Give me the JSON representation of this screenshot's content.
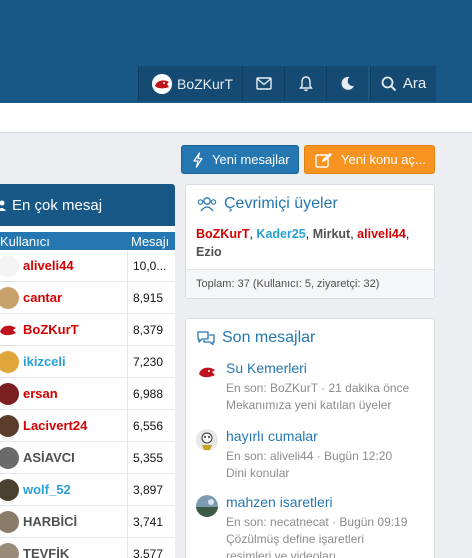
{
  "nav": {
    "user": "BoZKurT",
    "search": "Ara"
  },
  "buttons": {
    "new_messages": "Yeni mesajlar",
    "new_thread": "Yeni konu aç..."
  },
  "top_posters": {
    "title": "En çok mesaj",
    "col_user": "Kullanıcı",
    "col_messages": "Mesajı",
    "rows": [
      {
        "name": "aliveli44",
        "count": "10,0...",
        "color": "#d40000"
      },
      {
        "name": "cantar",
        "count": "8,915",
        "color": "#d40000"
      },
      {
        "name": "BoZKurT",
        "count": "8,379",
        "color": "#d40000"
      },
      {
        "name": "ikizceli",
        "count": "7,230",
        "color": "#2aa0d6"
      },
      {
        "name": "ersan",
        "count": "6,988",
        "color": "#d40000"
      },
      {
        "name": "Lacivert24",
        "count": "6,556",
        "color": "#d40000"
      },
      {
        "name": "ASİAVCI",
        "count": "5,355",
        "color": "#505050"
      },
      {
        "name": "wolf_52",
        "count": "3,897",
        "color": "#2aa0d6"
      },
      {
        "name": "HARBİCİ",
        "count": "3,741",
        "color": "#505050"
      },
      {
        "name": "TEVFİK",
        "count": "3,577",
        "color": "#505050"
      }
    ]
  },
  "online": {
    "title": "Çevrimiçi üyeler",
    "users": [
      {
        "name": "BoZKurT",
        "color": "#d40000"
      },
      {
        "name": "Kader25",
        "color": "#2aa0d6"
      },
      {
        "name": "Mirkut",
        "color": "#505050"
      },
      {
        "name": "aliveli44",
        "color": "#d40000"
      },
      {
        "name": "Ezio",
        "color": "#505050"
      }
    ],
    "footer": "Toplam: 37 (Kullanıcı: 5, ziyaretçi: 32)"
  },
  "recent": {
    "title": "Son mesajlar",
    "posts": [
      {
        "title": "Su Kemerleri",
        "meta": "En son: BoZKurT · 21 dakika önce",
        "forum": "Mekanımıza yeni katılan üyeler",
        "forum2": ""
      },
      {
        "title": "hayırlı cumalar",
        "meta": "En son: aliveli44 · Bugün 12:20",
        "forum": "Dini konular",
        "forum2": ""
      },
      {
        "title": "mahzen isaretleri",
        "meta": "En son: necatnecat · Bugün 09:19",
        "forum": "Çözülmüş define işaretleri",
        "forum2": "resimleri ve videoları"
      }
    ]
  }
}
